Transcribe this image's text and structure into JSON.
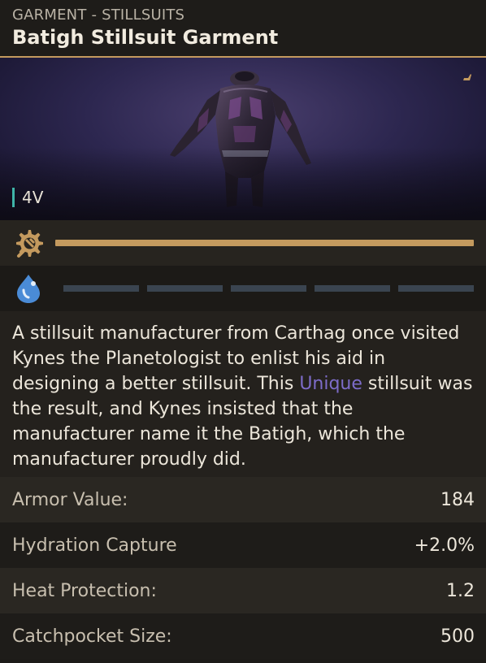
{
  "header": {
    "category": "GARMENT - STILLSUITS",
    "name": "Batigh Stillsuit Garment"
  },
  "preview": {
    "tier": "4V",
    "corner_icon": "unique-mark-icon",
    "image": "stillsuit-garment-render"
  },
  "durability": {
    "icon": "durability-gear-icon",
    "fraction": 1.0,
    "color": "#c49a5e"
  },
  "hydration": {
    "icon": "water-drop-icon",
    "segments_total": 5,
    "segments_filled": 0
  },
  "description": {
    "before": "A stillsuit manufacturer from Carthag once visited Kynes the Planetologist to enlist his aid in designing a better stillsuit. This ",
    "highlight": "Unique",
    "after": " stillsuit was the result, and Kynes insisted that the manufacturer name it the Batigh, which the manufacturer proudly did.",
    "highlight_color": "#7d6cc9"
  },
  "stats": [
    {
      "label": "Armor Value:",
      "value": "184"
    },
    {
      "label": "Hydration Capture",
      "value": "+2.0%"
    },
    {
      "label": "Heat Protection:",
      "value": "1.2"
    },
    {
      "label": "Catchpocket Size:",
      "value": "500"
    }
  ],
  "colors": {
    "accent": "#c49a5e",
    "tier": "#3fb4a8",
    "water": "#4a8bd6"
  }
}
